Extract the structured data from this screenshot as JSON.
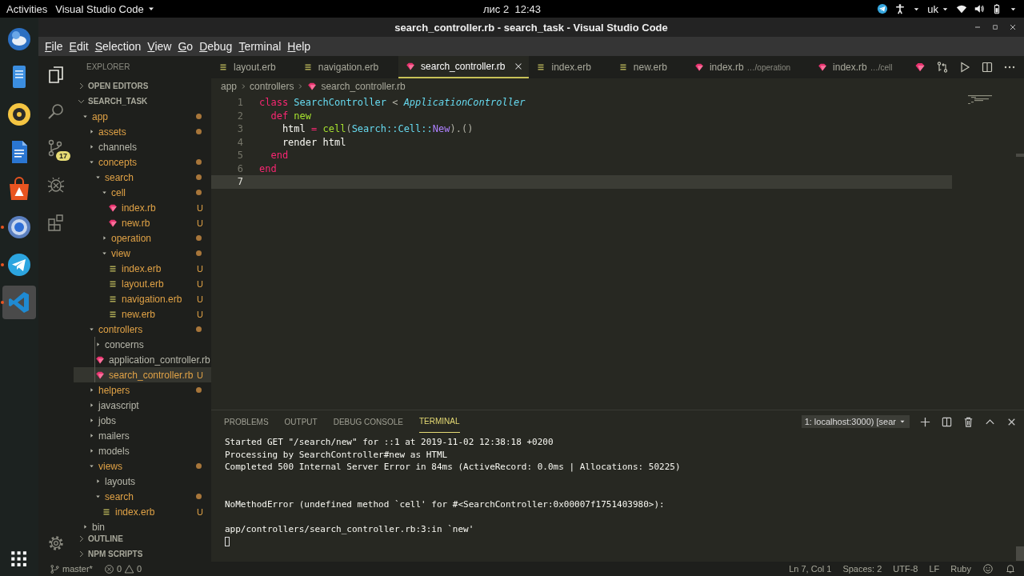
{
  "top_bar": {
    "activities": "Activities",
    "app_menu": "Visual Studio Code",
    "clock": "лис 2  12:43",
    "input_source": "uk"
  },
  "dock": [
    {
      "kind": "mail",
      "running": false,
      "selected": false
    },
    {
      "kind": "notes",
      "running": false,
      "selected": false
    },
    {
      "kind": "music",
      "running": false,
      "selected": false
    },
    {
      "kind": "document",
      "running": false,
      "selected": false
    },
    {
      "kind": "bag",
      "running": false,
      "selected": false
    },
    {
      "kind": "browser",
      "running": true,
      "selected": false
    },
    {
      "kind": "plane",
      "running": true,
      "selected": false
    },
    {
      "kind": "code",
      "running": true,
      "selected": true
    }
  ],
  "window": {
    "title": "search_controller.rb - search_task - Visual Studio Code"
  },
  "menu": [
    "File",
    "Edit",
    "Selection",
    "View",
    "Go",
    "Debug",
    "Terminal",
    "Help"
  ],
  "activity_bar": [
    {
      "kind": "files",
      "selected": true
    },
    {
      "kind": "search",
      "selected": false
    },
    {
      "kind": "scm",
      "selected": false,
      "badge": "17"
    },
    {
      "kind": "debug",
      "selected": false
    },
    {
      "kind": "extensions",
      "selected": false
    }
  ],
  "explorer": {
    "title": "EXPLORER",
    "open_editors": {
      "label": "OPEN EDITORS",
      "expanded": false
    },
    "project": {
      "label": "SEARCH_TASK",
      "expanded": true
    },
    "tree": [
      {
        "label": "app",
        "kind": "folder",
        "expanded": true,
        "changed": true,
        "selected": false,
        "children": [
          {
            "label": "assets",
            "kind": "folder",
            "expanded": false,
            "changed": true,
            "selected": false
          },
          {
            "label": "channels",
            "kind": "folder",
            "expanded": false,
            "changed": false,
            "selected": false
          },
          {
            "label": "concepts",
            "kind": "folder",
            "expanded": true,
            "changed": true,
            "selected": false,
            "children": [
              {
                "label": "search",
                "kind": "folder",
                "expanded": true,
                "changed": true,
                "selected": false,
                "children": [
                  {
                    "label": "cell",
                    "kind": "folder",
                    "expanded": true,
                    "changed": true,
                    "selected": false,
                    "children": [
                      {
                        "label": "index.rb",
                        "kind": "ruby",
                        "changed": true,
                        "badge": "U",
                        "selected": false
                      },
                      {
                        "label": "new.rb",
                        "kind": "ruby",
                        "changed": true,
                        "badge": "U",
                        "selected": false
                      }
                    ]
                  },
                  {
                    "label": "operation",
                    "kind": "folder",
                    "expanded": false,
                    "changed": true,
                    "selected": false
                  },
                  {
                    "label": "view",
                    "kind": "folder",
                    "expanded": true,
                    "changed": true,
                    "selected": false,
                    "children": [
                      {
                        "label": "index.erb",
                        "kind": "erb",
                        "changed": true,
                        "badge": "U",
                        "selected": false
                      },
                      {
                        "label": "layout.erb",
                        "kind": "erb",
                        "changed": true,
                        "badge": "U",
                        "selected": false
                      },
                      {
                        "label": "navigation.erb",
                        "kind": "erb",
                        "changed": true,
                        "badge": "U",
                        "selected": false
                      },
                      {
                        "label": "new.erb",
                        "kind": "erb",
                        "changed": true,
                        "badge": "U",
                        "selected": false
                      }
                    ]
                  }
                ]
              }
            ]
          },
          {
            "label": "controllers",
            "kind": "folder",
            "expanded": true,
            "changed": true,
            "selected": false,
            "children": [
              {
                "label": "concerns",
                "kind": "folder",
                "expanded": false,
                "changed": false,
                "selected": false
              },
              {
                "label": "application_controller.rb",
                "kind": "ruby",
                "changed": false,
                "selected": false
              },
              {
                "label": "search_controller.rb",
                "kind": "ruby",
                "changed": true,
                "badge": "U",
                "selected": true
              }
            ]
          },
          {
            "label": "helpers",
            "kind": "folder",
            "expanded": false,
            "changed": true,
            "selected": false
          },
          {
            "label": "javascript",
            "kind": "folder",
            "expanded": false,
            "changed": false,
            "selected": false
          },
          {
            "label": "jobs",
            "kind": "folder",
            "expanded": false,
            "changed": false,
            "selected": false
          },
          {
            "label": "mailers",
            "kind": "folder",
            "expanded": false,
            "changed": false,
            "selected": false
          },
          {
            "label": "models",
            "kind": "folder",
            "expanded": false,
            "changed": false,
            "selected": false
          },
          {
            "label": "views",
            "kind": "folder",
            "expanded": true,
            "changed": true,
            "selected": false,
            "children": [
              {
                "label": "layouts",
                "kind": "folder",
                "expanded": false,
                "changed": false,
                "selected": false
              },
              {
                "label": "search",
                "kind": "folder",
                "expanded": true,
                "changed": true,
                "selected": false,
                "children": [
                  {
                    "label": "index.erb",
                    "kind": "erb",
                    "changed": true,
                    "badge": "U",
                    "selected": false
                  }
                ]
              }
            ]
          }
        ]
      },
      {
        "label": "bin",
        "kind": "folder",
        "expanded": false,
        "changed": false,
        "selected": false
      }
    ],
    "sections": [
      {
        "label": "OUTLINE",
        "expanded": false
      },
      {
        "label": "NPM SCRIPTS",
        "expanded": false
      }
    ]
  },
  "tabs": [
    {
      "label": "layout.erb",
      "kind": "erb",
      "selected": false
    },
    {
      "label": "navigation.erb",
      "kind": "erb",
      "selected": false
    },
    {
      "label": "search_controller.rb",
      "kind": "ruby",
      "selected": true
    },
    {
      "label": "index.erb",
      "kind": "erb",
      "selected": false
    },
    {
      "label": "new.erb",
      "kind": "erb",
      "selected": false
    },
    {
      "label": "index.rb",
      "kind": "ruby",
      "selected": false,
      "description": "…/operation"
    },
    {
      "label": "index.rb",
      "kind": "ruby",
      "selected": false,
      "description": "…/cell"
    }
  ],
  "editor": {
    "breadcrumb": [
      {
        "label": "app",
        "kind": "folder"
      },
      {
        "label": "controllers",
        "kind": "folder"
      },
      {
        "label": "search_controller.rb",
        "kind": "ruby"
      }
    ],
    "lines": [
      {
        "number": "1",
        "current": false,
        "tokens": [
          {
            "text": "class ",
            "kind": "keyword"
          },
          {
            "text": "SearchController ",
            "kind": "class"
          },
          {
            "text": "< ",
            "kind": "punct"
          },
          {
            "text": "ApplicationController",
            "kind": "inherit"
          }
        ]
      },
      {
        "number": "2",
        "current": false,
        "tokens": [
          {
            "text": "  def ",
            "kind": "keyword"
          },
          {
            "text": "new",
            "kind": "function"
          }
        ]
      },
      {
        "number": "3",
        "current": false,
        "tokens": [
          {
            "text": "    html ",
            "kind": "plain"
          },
          {
            "text": "= ",
            "kind": "keyword"
          },
          {
            "text": "cell",
            "kind": "function"
          },
          {
            "text": "(",
            "kind": "punct"
          },
          {
            "text": "Search::Cell::",
            "kind": "class"
          },
          {
            "text": "New",
            "kind": "constant"
          },
          {
            "text": ").()",
            "kind": "punct"
          }
        ]
      },
      {
        "number": "4",
        "current": false,
        "tokens": [
          {
            "text": "    render html",
            "kind": "plain"
          }
        ]
      },
      {
        "number": "5",
        "current": false,
        "tokens": [
          {
            "text": "  end",
            "kind": "keyword"
          }
        ]
      },
      {
        "number": "6",
        "current": false,
        "tokens": [
          {
            "text": "end",
            "kind": "keyword"
          }
        ]
      },
      {
        "number": "7",
        "current": true
      }
    ]
  },
  "panel": {
    "tabs": [
      {
        "label": "PROBLEMS",
        "selected": false
      },
      {
        "label": "OUTPUT",
        "selected": false
      },
      {
        "label": "DEBUG CONSOLE",
        "selected": false
      },
      {
        "label": "TERMINAL",
        "selected": true
      }
    ],
    "terminal_select": "1: localhost:3000) [sear",
    "blocks": [
      {
        "lines": [
          "Started GET \"/search/new\" for ::1 at 2019-11-02 12:38:18 +0200",
          "Processing by SearchController#new as HTML",
          "Completed 500 Internal Server Error in 84ms (ActiveRecord: 0.0ms | Allocations: 50225)"
        ]
      },
      {
        "lines": [
          "NoMethodError (undefined method `cell' for #<SearchController:0x00007f1751403980>):"
        ]
      },
      {
        "lines": [
          "app/controllers/search_controller.rb:3:in `new'"
        ]
      }
    ]
  },
  "status_bar": {
    "branch": "master*",
    "errors": "0",
    "warnings": "0",
    "items": [
      "Ln 7, Col 1",
      "Spaces: 2",
      "UTF-8",
      "LF",
      "Ruby"
    ]
  }
}
